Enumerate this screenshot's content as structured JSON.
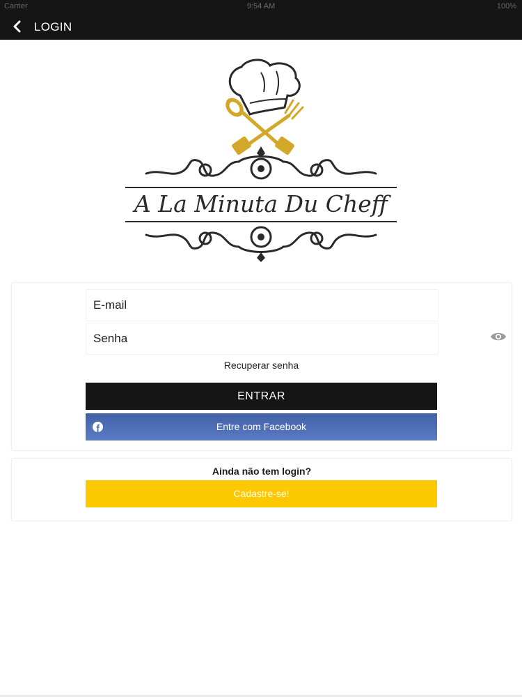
{
  "status_bar": {
    "carrier": "Carrier",
    "time": "9:54 AM",
    "battery": "100%"
  },
  "nav": {
    "back_icon": "chevron-left-icon",
    "title": "LOGIN"
  },
  "logo": {
    "text": "A La Minuta Du Cheff",
    "gold": "#d3a72a"
  },
  "form": {
    "email_label": "E-mail",
    "password_label": "Senha",
    "eye_icon": "eye-icon",
    "recover_label": "Recuperar senha",
    "login_button": "ENTRAR",
    "facebook_button": "Entre com Facebook",
    "facebook_icon": "facebook-icon"
  },
  "signup": {
    "question": "Ainda não tem login?",
    "button": "Cadastre-se!"
  },
  "colors": {
    "nav_bg": "#151515",
    "login_btn": "#151515",
    "facebook_btn": "#4a69b0",
    "signup_btn": "#fcc800"
  }
}
